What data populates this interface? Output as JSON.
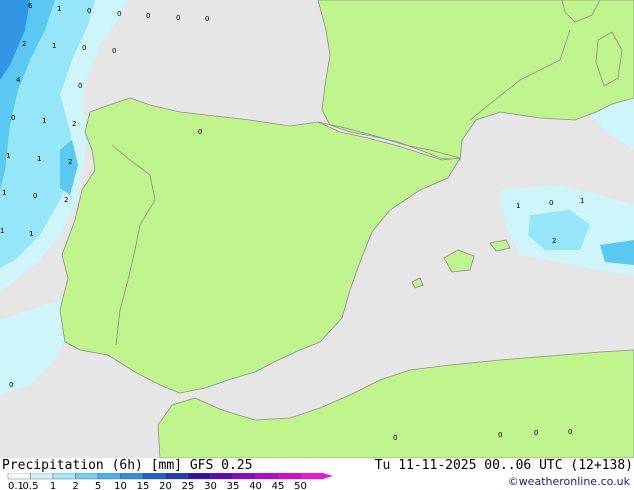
{
  "colors": {
    "sea": "#e6e6e6",
    "land": "#bff58c",
    "border": "#8c8c8c",
    "precip_light": "#cdf5fa",
    "precip_mid": "#96e6fa",
    "precip_strong": "#5ac8f0",
    "precip_heavy": "#3296e6"
  },
  "footer": {
    "product": "Precipitation (6h) [mm] GFS 0.25",
    "valid": "Tu 11-11-2025 00..06 UTC (12+138)",
    "credit": "©weatheronline.co.uk"
  },
  "legend": {
    "ticks": [
      "0.1",
      "0.5",
      "1",
      "2",
      "5",
      "10",
      "15",
      "20",
      "25",
      "30",
      "35",
      "40",
      "45",
      "50"
    ],
    "colors": [
      "#f5fcfd",
      "#cdf5fa",
      "#a0e8fa",
      "#6ed2f5",
      "#46b4ee",
      "#2f8fe0",
      "#2060d0",
      "#1c3cb8",
      "#3010a8",
      "#5a08b8",
      "#8a08c8",
      "#b408d0",
      "#d808d8",
      "#f018d8"
    ]
  },
  "labels": [
    {
      "t": "6"
    },
    {
      "t": "1"
    },
    {
      "t": "0"
    },
    {
      "t": "0"
    },
    {
      "t": "0"
    },
    {
      "t": "0"
    },
    {
      "t": "0"
    },
    {
      "t": "2"
    },
    {
      "t": "1"
    },
    {
      "t": "0"
    },
    {
      "t": "0"
    },
    {
      "t": "4"
    },
    {
      "t": "0"
    },
    {
      "t": "0"
    },
    {
      "t": "1"
    },
    {
      "t": "2"
    },
    {
      "t": "1"
    },
    {
      "t": "1"
    },
    {
      "t": "2"
    },
    {
      "t": "1"
    },
    {
      "t": "0"
    },
    {
      "t": "2"
    },
    {
      "t": "1"
    },
    {
      "t": "1"
    },
    {
      "t": "0"
    },
    {
      "t": "1"
    },
    {
      "t": "0"
    },
    {
      "t": "1"
    },
    {
      "t": "2"
    },
    {
      "t": "0"
    },
    {
      "t": "0"
    },
    {
      "t": "0"
    },
    {
      "t": "0"
    },
    {
      "t": "0"
    }
  ]
}
